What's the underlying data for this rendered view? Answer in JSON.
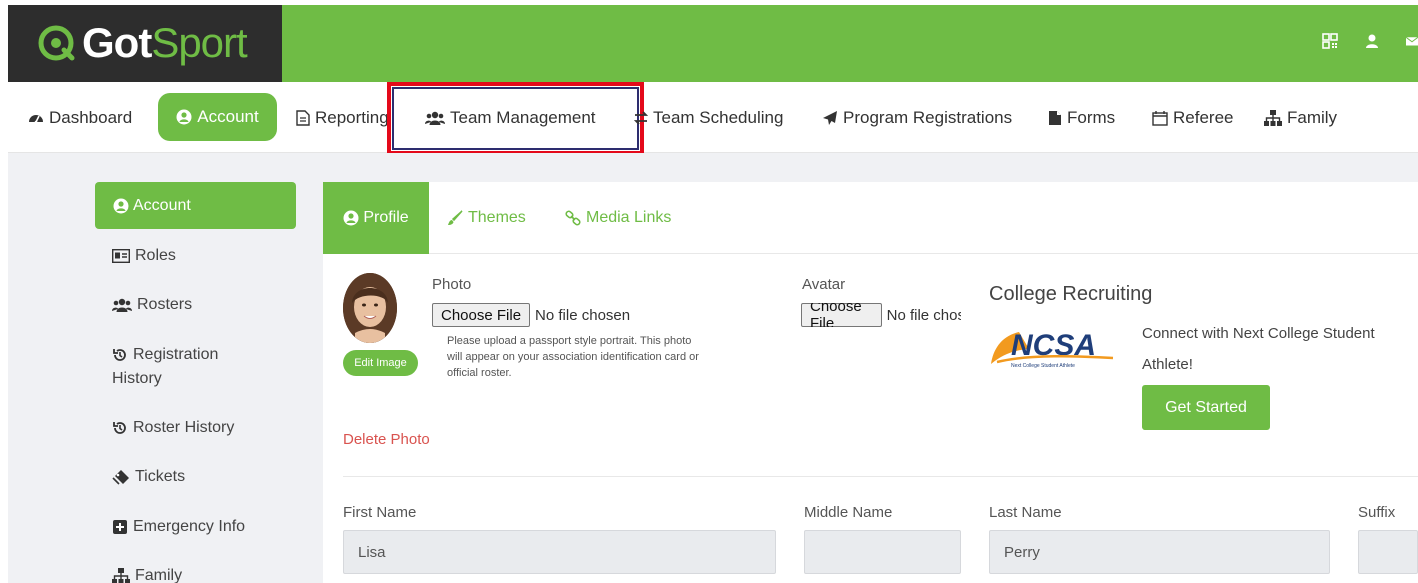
{
  "brand": {
    "got": "Got",
    "sport": "Sport"
  },
  "nav": {
    "dashboard": "Dashboard",
    "account": "Account",
    "reporting": "Reporting",
    "team_management": "Team Management",
    "team_scheduling": "Team Scheduling",
    "program_registrations": "Program Registrations",
    "forms": "Forms",
    "referee": "Referee",
    "family": "Family"
  },
  "sidebar": {
    "account": "Account",
    "roles": "Roles",
    "rosters": "Rosters",
    "registration_history_line1": "Registration",
    "registration_history_line2": "History",
    "roster_history": "Roster History",
    "tickets": "Tickets",
    "emergency_info": "Emergency Info",
    "family": "Family"
  },
  "tabs": {
    "profile": "Profile",
    "themes": "Themes",
    "media_links": "Media Links"
  },
  "photo": {
    "label": "Photo",
    "choose_file": "Choose File",
    "status": "No file chosen",
    "hint": "Please upload a passport style portrait. This photo will appear on your association identification card or official roster.",
    "edit_image": "Edit Image",
    "delete_photo": "Delete Photo"
  },
  "avatar": {
    "label": "Avatar",
    "choose_file": "Choose File",
    "status": "No file chosen"
  },
  "recruiting": {
    "title": "College Recruiting",
    "logo_text": "NCSA",
    "logo_sub": "Next College Student Athlete",
    "line1": "Connect with Next College Student",
    "line2": "Athlete!",
    "get_started": "Get Started"
  },
  "form": {
    "first_name_label": "First Name",
    "first_name": "Lisa",
    "middle_name_label": "Middle Name",
    "middle_name": "",
    "last_name_label": "Last Name",
    "last_name": "Perry",
    "suffix_label": "Suffix",
    "suffix": ""
  },
  "colors": {
    "brand_green": "#6fbc45",
    "header_dark": "#2d2d2d",
    "highlight_red": "#e4091a",
    "delete_red": "#d9534f"
  }
}
